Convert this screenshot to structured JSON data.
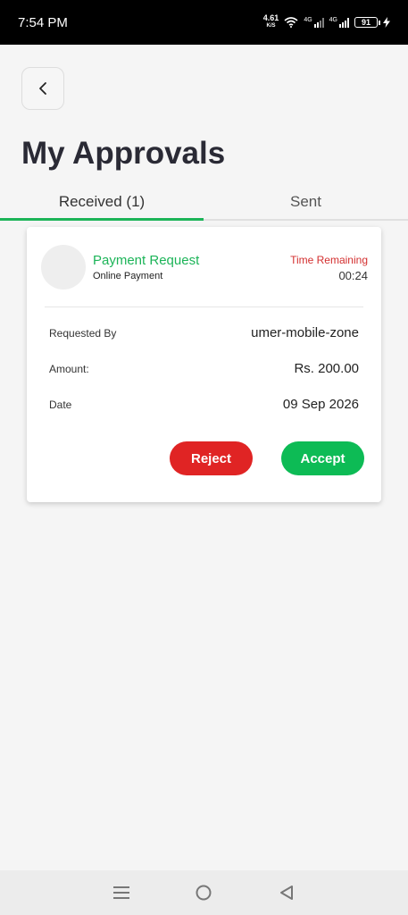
{
  "status_bar": {
    "time": "7:54 PM",
    "net_speed": "4.61",
    "net_unit": "K/S",
    "sim1": "4G",
    "sim2": "4G",
    "battery": "91"
  },
  "header": {
    "title": "My Approvals"
  },
  "tabs": [
    {
      "label": "Received (1)",
      "active": true
    },
    {
      "label": "Sent",
      "active": false
    }
  ],
  "approval_card": {
    "title": "Payment Request",
    "subtitle": "Online Payment",
    "time_remaining_label": "Time Remaining",
    "time_remaining_value": "00:24",
    "rows": [
      {
        "label": "Requested By",
        "value": "umer-mobile-zone"
      },
      {
        "label": "Amount:",
        "value": "Rs. 200.00"
      },
      {
        "label": "Date",
        "value": "09 Sep 2026"
      }
    ],
    "reject_label": "Reject",
    "accept_label": "Accept"
  },
  "colors": {
    "accent_green": "#1cb458",
    "reject_red": "#e02424",
    "timer_red": "#d32f2f"
  },
  "icons": {
    "back": "chevron-left-icon",
    "nav_menu": "menu-icon",
    "nav_home": "home-circle-icon",
    "nav_back": "triangle-back-icon"
  }
}
